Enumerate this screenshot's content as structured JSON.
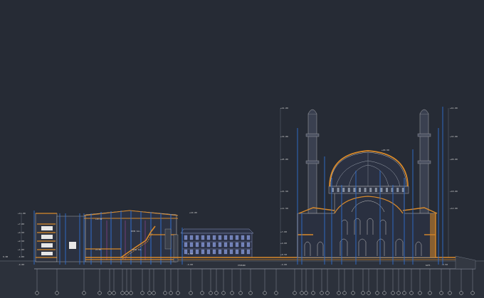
{
  "colors": {
    "background": "#262b35",
    "structure": "#d98a2b",
    "grid": "#2f6fd0",
    "line": "#c9c9c9",
    "dim": "#8a93a3",
    "magenta": "#b34db3",
    "ground": "#3a3f49"
  },
  "labels": {
    "elev_top_right": "+41.00",
    "elev_top_left": "+41.00",
    "elev_r2": "+33.00",
    "elev_l2": "+33.00",
    "elev_r3": "+28.00",
    "elev_l3": "+25.00",
    "elev_dome": "+29.50",
    "elev_r4": "+18.00",
    "elev_l4": "+21.50",
    "elev_r5": "+12.00",
    "elev_l5": "+11.50",
    "elev_l6": "+7.00",
    "elev_l7": "+4.00",
    "elev_l8": "+0.50",
    "elev_left1": "+7.00",
    "elev_left2": "+4.50",
    "elev_left3": "+2.50",
    "elev_left4": "+1.00",
    "elev_left5": "0.00",
    "elev_left6": "-1.00",
    "elev_left7": "-4.00",
    "elev_left8": "+11.00",
    "elev_left9": "+2.50",
    "elev_mid1": "+10.00",
    "elev_mid2": "-0.50",
    "elev_mid3": "-4.00",
    "elev_right_low": "-2.50",
    "room1": "SPOR SAL.",
    "room2": "SPOR SAL.",
    "room3": "OTOPARK",
    "room4": "KAFE.",
    "tag1": "+10.00",
    "tag2": "+5.00"
  }
}
